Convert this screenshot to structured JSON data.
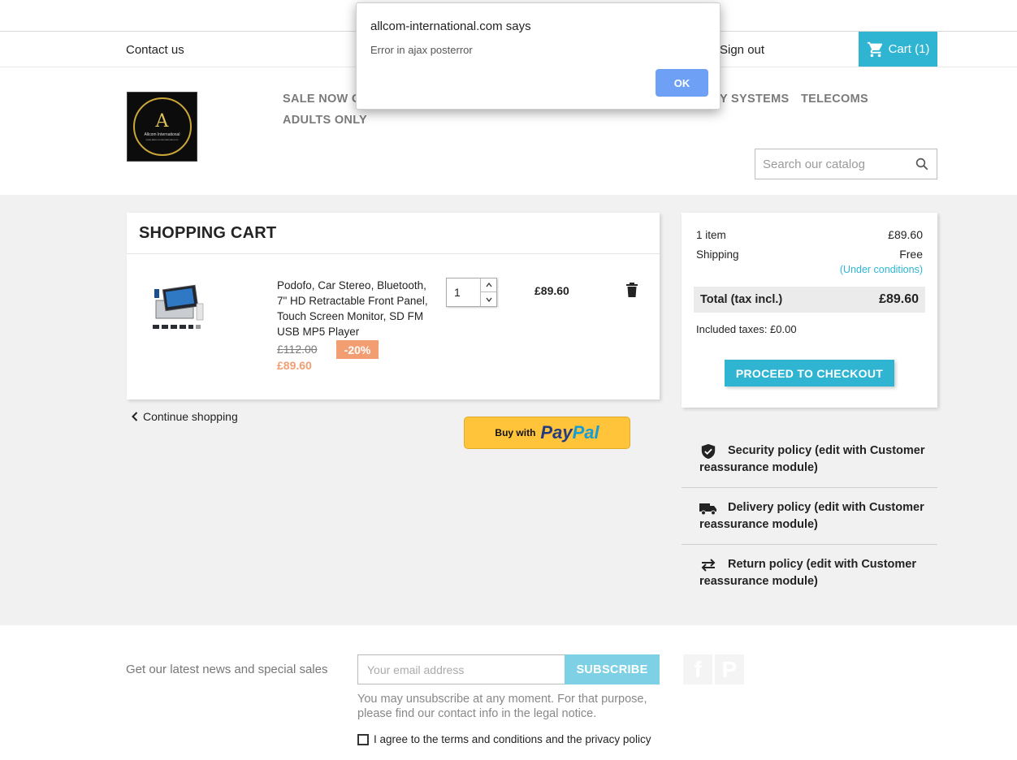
{
  "nav": {
    "contact": "Contact us",
    "signout": "Sign out",
    "cart": "Cart (1)"
  },
  "menu": {
    "items": [
      "SALE NOW O",
      "Y SYSTEMS",
      "TELECOMS",
      "ADULTS ONLY"
    ]
  },
  "logo": {
    "letter": "A",
    "name": "Allcom International",
    "tagline": "www.allcom-international.com"
  },
  "search": {
    "placeholder": "Search our catalog"
  },
  "cart": {
    "title": "SHOPPING CART",
    "product": {
      "name": "Podofo, Car Stereo, Bluetooth, 7\" HD Retractable Front Panel, Touch Screen Monitor, SD FM USB MP5 Player",
      "old_price": "£112.00",
      "discount": "-20%",
      "price": "£89.60",
      "quantity": "1",
      "line_total": "£89.60"
    },
    "continue": "Continue shopping",
    "paypal": {
      "buy_with": "Buy with",
      "brand1": "Pay",
      "brand2": "Pal"
    }
  },
  "summary": {
    "items_label": "1 item",
    "items_value": "£89.60",
    "shipping_label": "Shipping",
    "shipping_value": "Free",
    "conditions": "(Under conditions)",
    "total_label": "Total (tax incl.)",
    "total_value": "£89.60",
    "taxes": "Included taxes: £0.00",
    "checkout": "PROCEED TO CHECKOUT"
  },
  "reassurance": [
    {
      "icon": "shield-icon",
      "text": "Security policy (edit with Customer reassurance module)"
    },
    {
      "icon": "truck-icon",
      "text": "Delivery policy (edit with Customer reassurance module)"
    },
    {
      "icon": "arrows-icon",
      "text": "Return policy (edit with Customer reassurance module)"
    }
  ],
  "footer": {
    "newsletter_label": "Get our latest news and special sales",
    "email_placeholder": "Your email address",
    "subscribe": "SUBSCRIBE",
    "unsubscribe_note": "You may unsubscribe at any moment. For that purpose, please find our contact info in the legal notice.",
    "agree": "I agree to the terms and conditions and the privacy policy",
    "social": [
      "f",
      "P"
    ]
  },
  "dialog": {
    "title": "allcom-international.com says",
    "message": "Error in ajax posterror",
    "ok": "OK"
  },
  "colors": {
    "accent": "#2fb5d2",
    "discount": "#f39d72",
    "paypal": "#ffc439",
    "dialog_button": "#6ea1f5"
  }
}
